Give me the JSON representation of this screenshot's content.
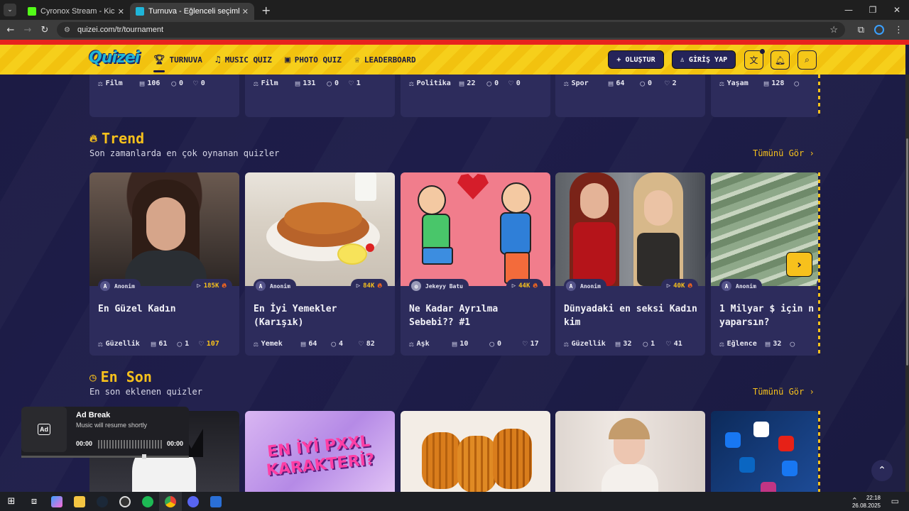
{
  "browser": {
    "tabs": [
      {
        "title": "Cyronox Stream - Kick Dashboard",
        "favicon_color": "#53fc18",
        "active": false
      },
      {
        "title": "Turnuva - Eğlenceli seçimler yap",
        "favicon_color": "#1fb5d9",
        "active": true
      }
    ],
    "url": "quizei.com/tr/tournament"
  },
  "site": {
    "logo": "Quizei",
    "nav": [
      {
        "label": "TURNUVA",
        "icon": "trophy-icon",
        "active": true
      },
      {
        "label": "MUSIC QUIZ",
        "icon": "music-note-icon",
        "active": false
      },
      {
        "label": "PHOTO QUIZ",
        "icon": "camera-icon",
        "active": false
      },
      {
        "label": "LEADERBOARD",
        "icon": "award-icon",
        "active": false
      }
    ],
    "create_label": "+ OLUŞTUR",
    "login_label": "GİRİŞ YAP"
  },
  "top_row": [
    {
      "category": "Film",
      "questions": "106",
      "comments": "0",
      "likes": "0"
    },
    {
      "category": "Film",
      "questions": "131",
      "comments": "0",
      "likes": "1"
    },
    {
      "category": "Politika",
      "questions": "22",
      "comments": "0",
      "likes": "0"
    },
    {
      "category": "Spor",
      "questions": "64",
      "comments": "0",
      "likes": "2"
    },
    {
      "category": "Yaşam",
      "questions": "128",
      "comments": "",
      "likes": ""
    }
  ],
  "trend": {
    "title": "Trend",
    "subtitle": "Son zamanlarda en çok oynanan quizler",
    "see_all": "Tümünü Gör",
    "cards": [
      {
        "title": "En Güzel Kadın",
        "author": "Anonim",
        "plays": "185K",
        "category": "Güzellik",
        "questions": "61",
        "comments": "1",
        "likes": "107",
        "likes_hot": true
      },
      {
        "title": "En İyi Yemekler (Karışık)",
        "author": "Anonim",
        "plays": "84K",
        "category": "Yemek",
        "questions": "64",
        "comments": "4",
        "likes": "82",
        "likes_hot": false
      },
      {
        "title": "Ne Kadar Ayrılma Sebebi?? #1",
        "author": "Jekeyy Batu",
        "plays": "44K",
        "category": "Aşk",
        "questions": "10",
        "comments": "0",
        "likes": "17",
        "likes_hot": false
      },
      {
        "title": "Dünyadaki en seksi Kadın kim",
        "author": "Anonim",
        "plays": "40K",
        "category": "Güzellik",
        "questions": "32",
        "comments": "1",
        "likes": "41",
        "likes_hot": false
      },
      {
        "title": "1 Milyar $ için n yaparsın?",
        "author": "Anonim",
        "plays": "",
        "category": "Eğlence",
        "questions": "32",
        "comments": "",
        "likes": "",
        "likes_hot": false
      }
    ]
  },
  "latest": {
    "title": "En Son",
    "subtitle": "En son eklenen quizler",
    "see_all": "Tümünü Gör",
    "card2_text": "EN İYİ PXXL KARAKTERİ?"
  },
  "ad": {
    "icon_label": "Ad",
    "title": "Ad Break",
    "subtitle": "Music will resume shortly",
    "time_start": "00:00",
    "time_end": "00:00"
  },
  "taskbar": {
    "time": "22:18",
    "date": "26.08.2025"
  }
}
